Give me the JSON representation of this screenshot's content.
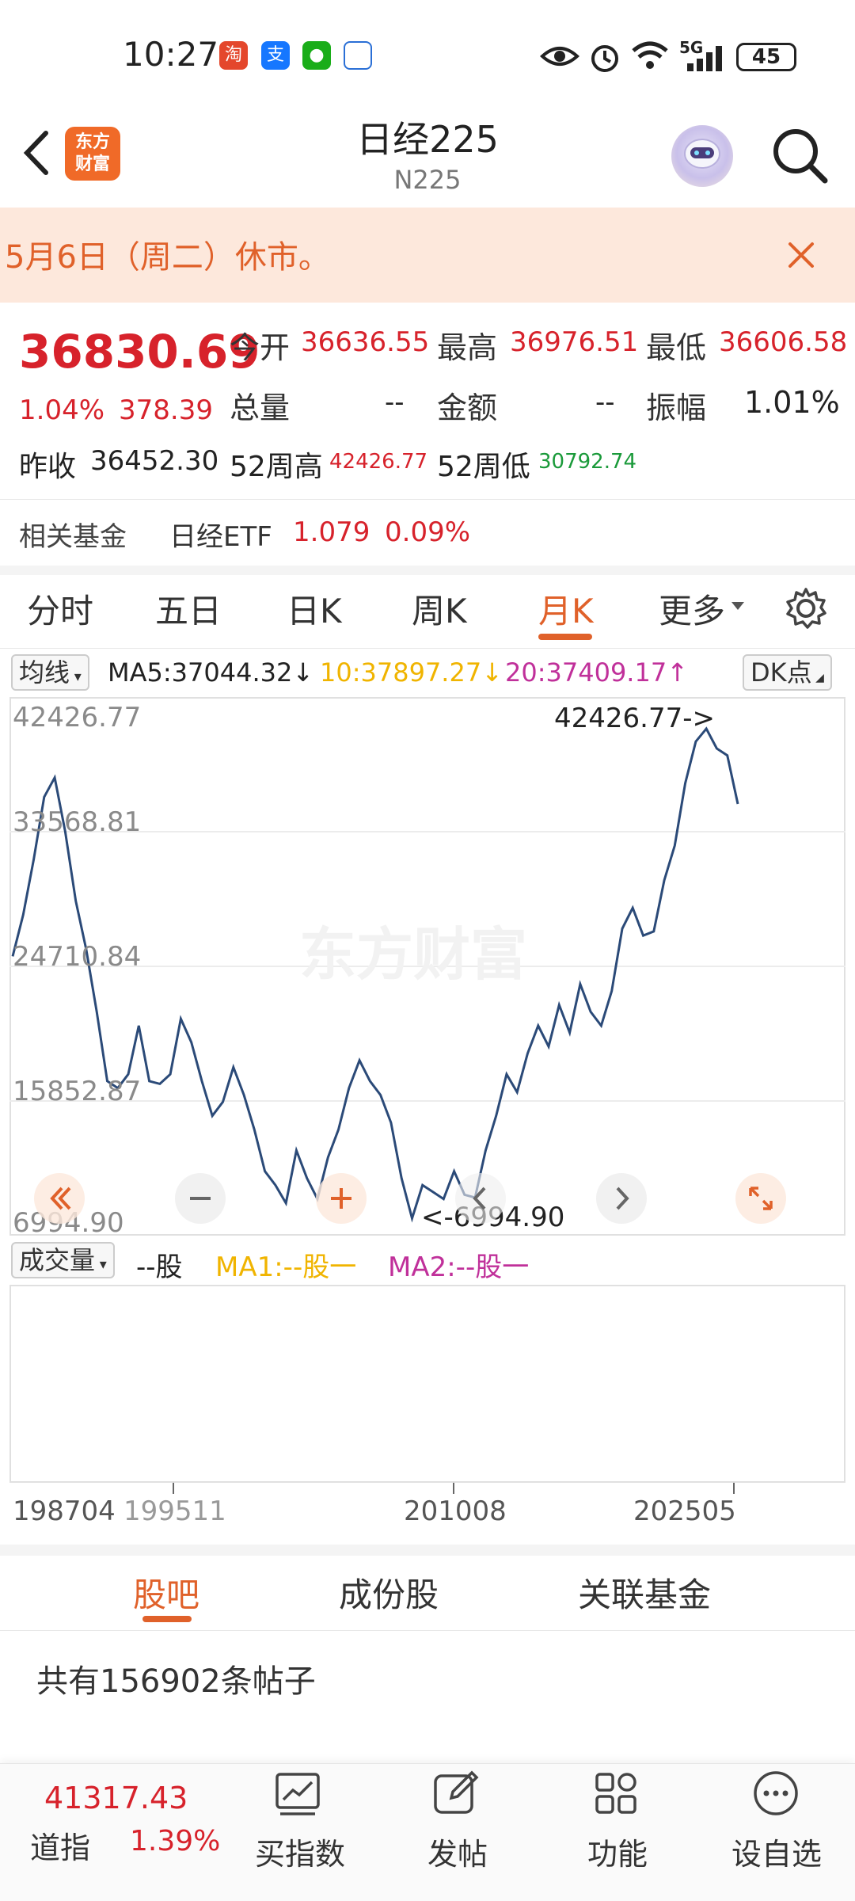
{
  "status_bar": {
    "time": "10:27",
    "battery": "45",
    "network": "5G"
  },
  "header": {
    "title": "日经225",
    "subtitle": "N225",
    "logo_text": "东方财富"
  },
  "notice": {
    "text": "5月6日（周二）休市。"
  },
  "quote": {
    "price": "36830.69",
    "change_pct": "1.04%",
    "change_abs": "378.39",
    "open_label": "今开",
    "open": "36636.55",
    "high_label": "最高",
    "high": "36976.51",
    "low_label": "最低",
    "low": "36606.58",
    "volume_label": "总量",
    "volume": "--",
    "amount_label": "金额",
    "amount": "--",
    "amplitude_label": "振幅",
    "amplitude": "1.01%",
    "prev_close_label": "昨收",
    "prev_close": "36452.30",
    "w52_high_label": "52周高",
    "w52_high": "42426.77",
    "w52_low_label": "52周低",
    "w52_low": "30792.74"
  },
  "related_fund": {
    "label": "相关基金",
    "name": "日经ETF",
    "price": "1.079",
    "change": "0.09%"
  },
  "chart_tabs": [
    "分时",
    "五日",
    "日K",
    "周K",
    "月K",
    "更多"
  ],
  "ma": {
    "selector": "均线",
    "ma5": "MA5:37044.32↓",
    "ma10": "10:37897.27↓",
    "ma20": "20:37409.17↑",
    "dk": "DK点"
  },
  "colors": {
    "accent": "#e0612a",
    "up": "#d7222b",
    "down": "#1a9a3a",
    "ma10": "#f0b400",
    "ma20": "#c0309a",
    "line": "#2b4a78"
  },
  "chart_data": {
    "type": "line",
    "y_ticks": [
      "42426.77",
      "33568.81",
      "24710.84",
      "15852.87",
      "6994.90"
    ],
    "ylim": [
      6994.9,
      42426.77
    ],
    "x_ticks": [
      "198704",
      "199511",
      "201008",
      "202505"
    ],
    "max_label": "42426.77->",
    "min_label": "<-6994.90",
    "watermark": "东方财富",
    "series": [
      {
        "values": [
          26000,
          29000,
          33000,
          37500,
          38900,
          35000,
          30000,
          26500,
          22000,
          17000,
          16500,
          17500,
          21000,
          17000,
          16800,
          17500,
          21500,
          19800,
          17000,
          14500,
          15500,
          18000,
          16000,
          13500,
          10500,
          9500,
          8200,
          12000,
          10000,
          8500,
          11500,
          13500,
          16500,
          18500,
          17000,
          16000,
          14000,
          10000,
          7100,
          9500,
          9000,
          8500,
          10500,
          8800,
          8600,
          12000,
          14500,
          17500,
          16200,
          19000,
          21000,
          19500,
          22500,
          20500,
          24000,
          22000,
          21000,
          23500,
          28000,
          29500,
          27500,
          27800,
          31500,
          34000,
          38500,
          41500,
          42426.77,
          41000,
          40500,
          37000
        ]
      }
    ]
  },
  "volume": {
    "selector": "成交量",
    "unit": "--股",
    "ma1": "MA1:--股一",
    "ma2": "MA2:--股一"
  },
  "bottom_tabs": [
    "股吧",
    "成份股",
    "关联基金"
  ],
  "post_count": "共有156902条帖子",
  "bottom_nav": {
    "dji_value": "41317.43",
    "dji_label": "道指",
    "dji_change": "1.39%",
    "items": [
      "买指数",
      "发帖",
      "功能",
      "设自选"
    ]
  }
}
